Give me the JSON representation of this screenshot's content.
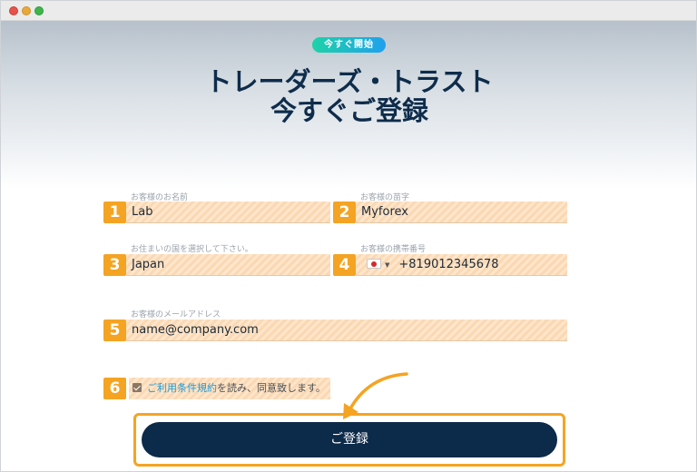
{
  "badge": "今すぐ開始",
  "title_line1": "トレーダーズ・トラスト",
  "title_line2": "今すぐご登録",
  "fields": {
    "first_name": {
      "number": "1",
      "label": "お客様のお名前",
      "value": "Lab"
    },
    "last_name": {
      "number": "2",
      "label": "お客様の苗字",
      "value": "Myforex"
    },
    "country": {
      "number": "3",
      "label": "お住まいの国を選択して下さい。",
      "value": "Japan"
    },
    "phone": {
      "number": "4",
      "label": "お客様の携帯番号",
      "value": "+819012345678",
      "flag": "japan-flag-icon"
    },
    "email": {
      "number": "5",
      "label": "お客様のメールアドレス",
      "value": "name@company.com"
    }
  },
  "terms": {
    "number": "6",
    "link_text": "ご利用条件規約",
    "text": "を読み、同意致します。",
    "checked": true
  },
  "submit_label": "ご登録",
  "colors": {
    "accent_orange": "#f4a422",
    "navy": "#0c2a49",
    "badge_start": "#1dd3a7",
    "badge_end": "#1fa0ee",
    "link": "#1e9ad6"
  }
}
